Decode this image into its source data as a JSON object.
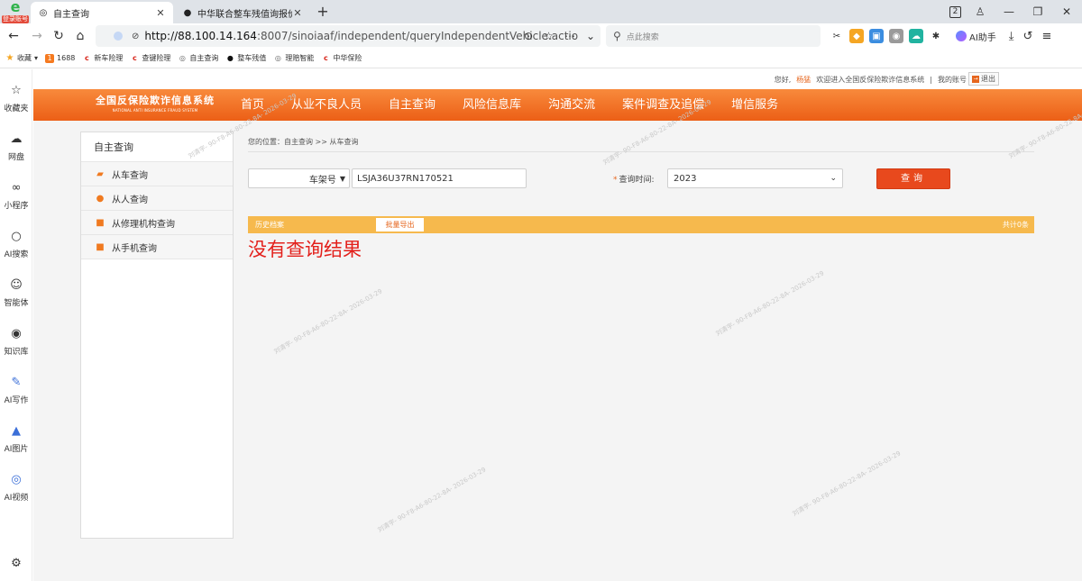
{
  "browser": {
    "login_badge": "登录账号",
    "tabs": [
      {
        "title": "自主查询",
        "active": true
      },
      {
        "title": "中华联合整车残值询报价公司",
        "active": false
      }
    ],
    "new_tab": "+",
    "tab_count": "2",
    "url_host": "http://88.100.14.164",
    "url_rest": ":8007/sinoiaaf/independent/queryIndependentVehicle.actio",
    "search_placeholder": "点此搜索",
    "ai_helper": "AI助手",
    "bookmarks": [
      {
        "label": "收藏",
        "icon": "star-icon"
      },
      {
        "label": "1688",
        "icon": "1688-icon"
      },
      {
        "label": "新车险理",
        "icon": "cic-icon"
      },
      {
        "label": "查键险理",
        "icon": "cic-icon"
      },
      {
        "label": "自主查询",
        "icon": "globe-icon"
      },
      {
        "label": "整车残值",
        "icon": "car-icon"
      },
      {
        "label": "理赔智能",
        "icon": "globe-icon"
      },
      {
        "label": "中华保险",
        "icon": "cic-icon"
      }
    ],
    "sidebar": [
      {
        "label": "收藏夹",
        "icon": "☆"
      },
      {
        "label": "网盘",
        "icon": "☁"
      },
      {
        "label": "小程序",
        "icon": "∞"
      },
      {
        "label": "AI搜索",
        "icon": "○"
      },
      {
        "label": "智能体",
        "icon": "☺"
      },
      {
        "label": "知识库",
        "icon": "◉"
      },
      {
        "label": "AI写作",
        "icon": "✎"
      },
      {
        "label": "AI图片",
        "icon": "▲"
      },
      {
        "label": "AI视频",
        "icon": "◎"
      }
    ],
    "settings_icon": "⚙"
  },
  "site": {
    "greeting": "您好,",
    "username": "杨猛",
    "welcome": "欢迎进入全国反保险欺诈信息系统",
    "separator": "|",
    "my_account": "我的账号",
    "logout": "退出",
    "logo_cn": "全国反保险欺诈信息系统",
    "logo_en": "NATIONAL ANTI INSURANCE FRAUD SYSTEM",
    "nav": [
      "首页",
      "从业不良人员",
      "自主查询",
      "风险信息库",
      "沟通交流",
      "案件调查及追偿",
      "增信服务"
    ]
  },
  "sidemenu": {
    "title": "自主查询",
    "items": [
      {
        "label": "从车查询",
        "icon": "car-icon"
      },
      {
        "label": "从人查询",
        "icon": "person-icon"
      },
      {
        "label": "从修理机构查询",
        "icon": "shop-icon"
      },
      {
        "label": "从手机查询",
        "icon": "phone-icon"
      }
    ]
  },
  "content": {
    "breadcrumb": "您的位置：自主查询 >> 从车查询",
    "type_select": "车架号",
    "vin_value": "LSJA36U37RN170521",
    "time_required_mark": "*",
    "time_label": "查询时间:",
    "year_value": "2023",
    "query_button": "查询",
    "history_tab": "历史档案",
    "export_button": "批量导出",
    "total": "共计0条",
    "no_result": "没有查询结果"
  },
  "watermark_text": "刘清宇- 90-F8-A6-80-22-8A- 2026-03-29"
}
